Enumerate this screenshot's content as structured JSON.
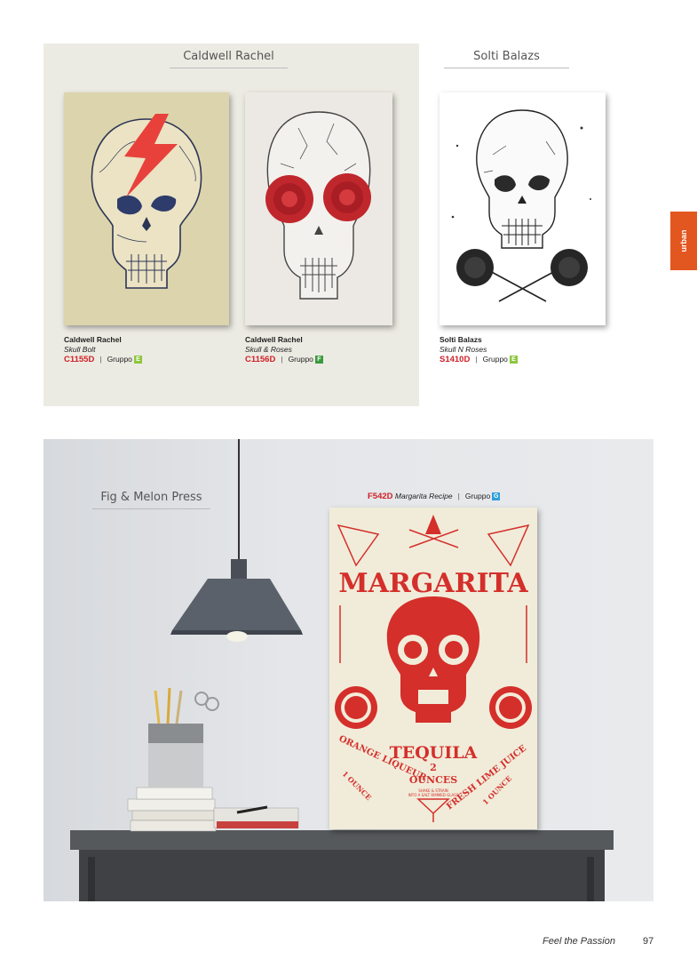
{
  "side_tab": {
    "label": "urban"
  },
  "top_section": {
    "headers": [
      {
        "name": "Caldwell Rachel"
      },
      {
        "name": "Solti Balazs"
      }
    ],
    "products": [
      {
        "artist": "Caldwell Rachel",
        "title": "Skull Bolt",
        "code": "C1155D",
        "group_label": "Gruppo",
        "group": "E",
        "group_color": "#8dc63f"
      },
      {
        "artist": "Caldwell Rachel",
        "title": "Skull & Roses",
        "code": "C1156D",
        "group_label": "Gruppo",
        "group": "F",
        "group_color": "#3a9a3e"
      },
      {
        "artist": "Solti Balazs",
        "title": "Skull N Roses",
        "code": "S1410D",
        "group_label": "Gruppo",
        "group": "E",
        "group_color": "#8dc63f"
      }
    ]
  },
  "feature": {
    "artist": "Fig & Melon Press",
    "code": "F542D",
    "title": "Margarita Recipe",
    "group_label": "Gruppo",
    "group": "G",
    "group_color": "#2f9fd8",
    "poster": {
      "headline": "MARGARITA",
      "tequila": "TEQUILA",
      "amount": "2",
      "ounces": "OUNCES",
      "small_text_1": "SHAKE & STRAIN",
      "small_text_2": "INTO A SALT RIMMED GLASS",
      "left_arc": "ORANGE LIQUEUR",
      "right_arc": "FRESH LIME JUICE",
      "left_ounce": "1 OUNCE",
      "right_ounce": "1 OUNCE"
    }
  },
  "footer": {
    "tagline": "Feel the Passion",
    "page_number": "97"
  },
  "colors": {
    "accent_red": "#cf2027",
    "tab_orange": "#e2571f",
    "panel_bg": "#ecebe3"
  }
}
